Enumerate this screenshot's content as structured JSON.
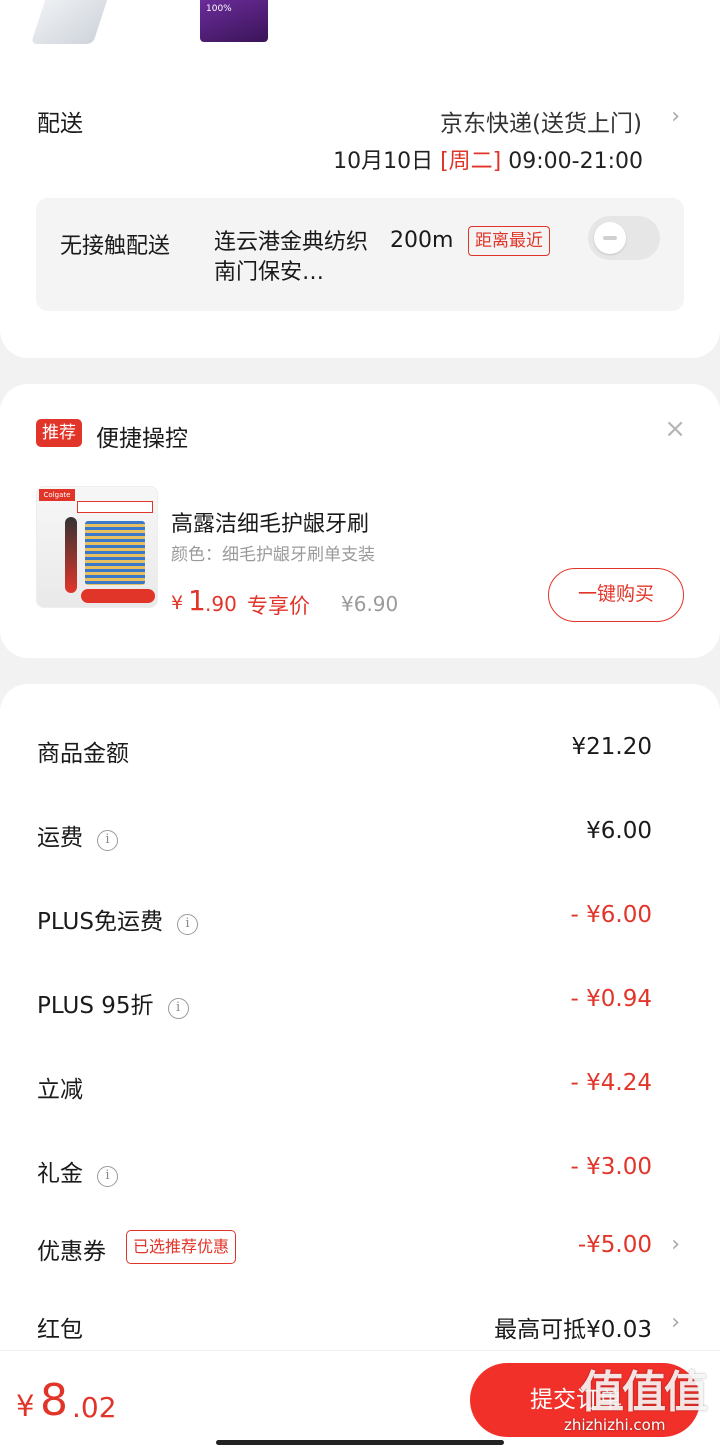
{
  "delivery": {
    "thumb_b_text": "100%",
    "label": "配送",
    "courier": "京东快递(送货上门)",
    "date": "10月10日 ",
    "weekday": "[周二]",
    "time": " 09:00-21:00",
    "no_contact": {
      "title": "无接触配送",
      "place": "连云港金典纺织南门保安…",
      "distance": "200m",
      "tag": "距离最近",
      "enabled": false
    }
  },
  "recommend": {
    "badge": "推荐",
    "title": "便捷操控",
    "product": {
      "name": "高露洁细毛护龈牙刷",
      "spec": "颜色：细毛护龈牙刷单支装",
      "price_yen": "¥",
      "price_int": "1",
      "price_dec": ".90",
      "price_tag": "专享价",
      "original_price": "¥6.90",
      "buy_label": "一键购买",
      "image_logo": "Colgate"
    }
  },
  "summary": {
    "rows": [
      {
        "label": "商品金额",
        "value": "¥21.20",
        "info": false,
        "red": false
      },
      {
        "label": "运费",
        "value": "¥6.00",
        "info": true,
        "red": false
      },
      {
        "label": "PLUS免运费",
        "value": "- ¥6.00",
        "info": true,
        "red": true
      },
      {
        "label": "PLUS 95折",
        "value": "- ¥0.94",
        "info": true,
        "red": true
      },
      {
        "label": "立减",
        "value": "- ¥4.24",
        "info": false,
        "red": true
      },
      {
        "label": "礼金",
        "value": "- ¥3.00",
        "info": true,
        "red": true
      }
    ],
    "coupon": {
      "label": "优惠券",
      "tag": "已选推荐优惠",
      "value": "-¥5.00"
    },
    "redpacket": {
      "label": "红包",
      "value": "最高可抵¥0.03"
    }
  },
  "bottom": {
    "total_yen": "¥",
    "total_int": "8",
    "total_dec": ".02",
    "submit_label": "提交订单"
  },
  "watermark": {
    "glyphs": "值值值",
    "url": "zhizhizhi.com"
  },
  "colors": {
    "accent": "#e2352a",
    "muted": "#9a9a9a"
  }
}
